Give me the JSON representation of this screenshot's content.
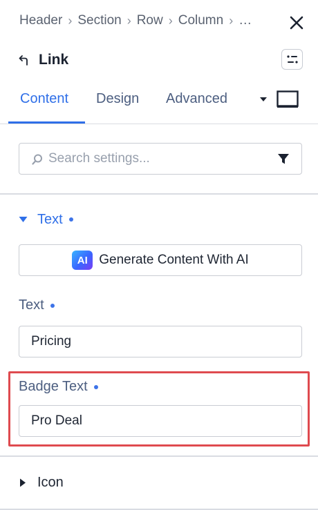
{
  "breadcrumb": {
    "items": [
      "Header",
      "Section",
      "Row",
      "Column"
    ],
    "overflow": "…"
  },
  "panel": {
    "title": "Link"
  },
  "tabs": [
    {
      "label": "Content",
      "active": true
    },
    {
      "label": "Design",
      "active": false
    },
    {
      "label": "Advanced",
      "active": false
    }
  ],
  "search": {
    "placeholder": "Search settings...",
    "value": ""
  },
  "text_section": {
    "title": "Text",
    "expanded": true,
    "ai_button_icon": "AI",
    "ai_button_label": "Generate Content With AI",
    "text_field": {
      "label": "Text",
      "value": "Pricing"
    },
    "badge_field": {
      "label": "Badge Text",
      "value": "Pro Deal"
    }
  },
  "icon_section": {
    "title": "Icon",
    "expanded": false
  },
  "colors": {
    "accent": "#2f6fe8",
    "highlight": "#df4a4f",
    "muted_label": "#4c5e80"
  },
  "icons": [
    "close-icon",
    "back-arrow-icon",
    "options-icon",
    "caret-down-icon",
    "device-desktop-icon",
    "search-icon",
    "filter-icon",
    "triangle-down-icon",
    "triangle-right-icon"
  ]
}
